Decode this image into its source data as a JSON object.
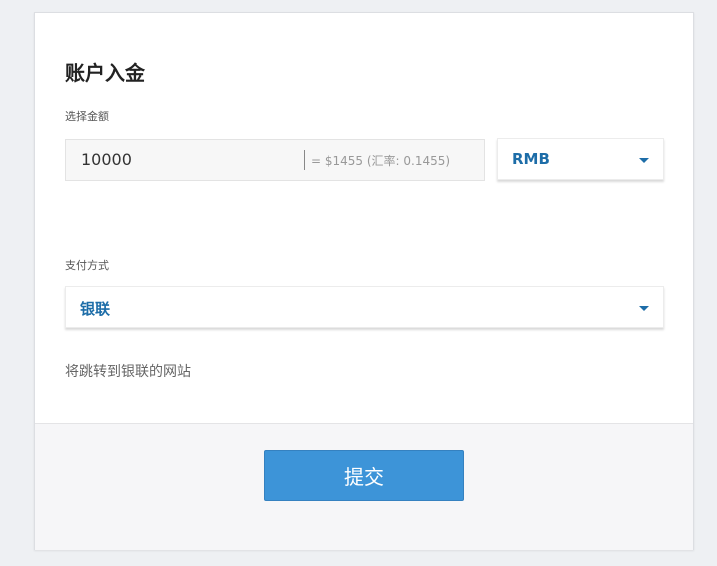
{
  "form": {
    "title": "账户入金",
    "amount_label": "选择金额",
    "amount_value": "10000",
    "conversion_text": "= $1455   (汇率: 0.1455)",
    "currency": "RMB",
    "payment_label": "支付方式",
    "payment_method": "银联",
    "redirect_note": "将跳转到银联的网站",
    "submit_label": "提交"
  },
  "colors": {
    "accent": "#1d6da8",
    "button": "#3d94d8"
  },
  "icons": {
    "caret": "chevron-down-icon"
  }
}
